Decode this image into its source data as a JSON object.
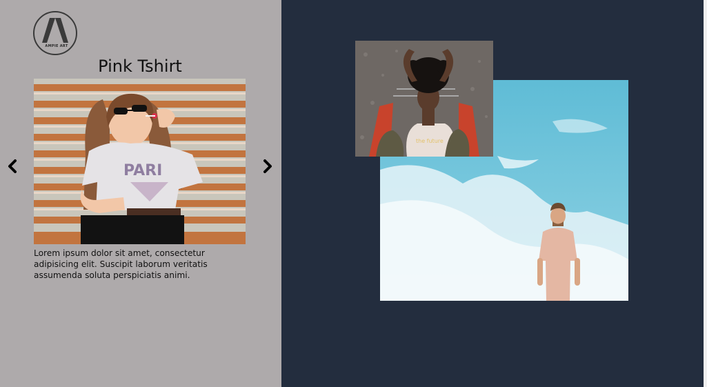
{
  "brand": {
    "logo_text": "AMPIE ART",
    "logo_letter": "A"
  },
  "product": {
    "title": "Pink Tshirt",
    "description": "Lorem ipsum dolor sit amet, consectetur adipisicing elit. Suscipit laborum veritatis assumenda soluta perspiciatis animi."
  },
  "carousel": {
    "prev_icon": "chevron-left-icon",
    "next_icon": "chevron-right-icon"
  },
  "colors": {
    "left_panel": "#aeaaab",
    "right_panel": "#232d3e",
    "sky": "#6fc3d9"
  }
}
